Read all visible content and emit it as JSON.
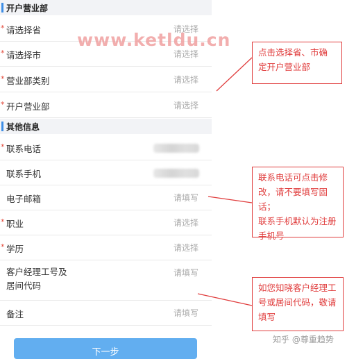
{
  "watermark": "www.ketldu.cn",
  "sections": {
    "account": {
      "title": "开户营业部"
    },
    "other": {
      "title": "其他信息"
    }
  },
  "rows": [
    {
      "label": "请选择省",
      "required": "*",
      "value": "请选择"
    },
    {
      "label": "请选择市",
      "required": "*",
      "value": "请选择"
    },
    {
      "label": "营业部类别",
      "required": "*",
      "value": "请选择"
    },
    {
      "label": "开户营业部",
      "required": "*",
      "value": "请选择"
    },
    {
      "label": "联系电话",
      "required": "*",
      "value": ""
    },
    {
      "label": "联系手机",
      "required": "",
      "value": ""
    },
    {
      "label": "电子邮箱",
      "required": "",
      "value": "请填写"
    },
    {
      "label": "职业",
      "required": "*",
      "value": "请选择"
    },
    {
      "label": "学历",
      "required": "*",
      "value": "请选择"
    },
    {
      "label": "客户经理工号及居间代码",
      "label_line1": "客户经理工号及",
      "label_line2": "居间代码",
      "required": "",
      "value": "请填写"
    },
    {
      "label": "备注",
      "required": "",
      "value": "请填写"
    }
  ],
  "next_button": "下一步",
  "callouts": {
    "c1": {
      "line1": "点击选择省、市确",
      "line2": "定开户营业部"
    },
    "c2": {
      "line1": "联系电话可点击修",
      "line2": "改，请不要填写固话；",
      "line3": "联系手机默认为注册",
      "line4": "手机号"
    },
    "c3": {
      "line1": "如您知晓客户经理工",
      "line2": "号或居间代码，敬请",
      "line3": "填写"
    }
  },
  "credit": "知乎 @尊重趋势",
  "colors": {
    "accent": "#3d8de5",
    "required": "#e24a3b",
    "callout": "#e03c3c",
    "button": "#62aef0"
  }
}
